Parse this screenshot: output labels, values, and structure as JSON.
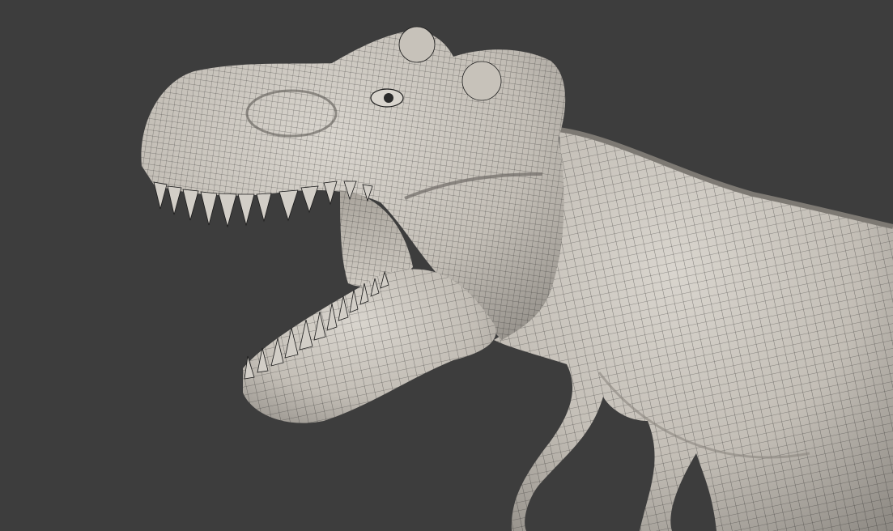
{
  "viewport": {
    "background": "#3d3d3d",
    "model_fill": "#bdb8b0",
    "wire_color": "#1b1b1b",
    "subject": "t-rex-head-wireframe"
  }
}
